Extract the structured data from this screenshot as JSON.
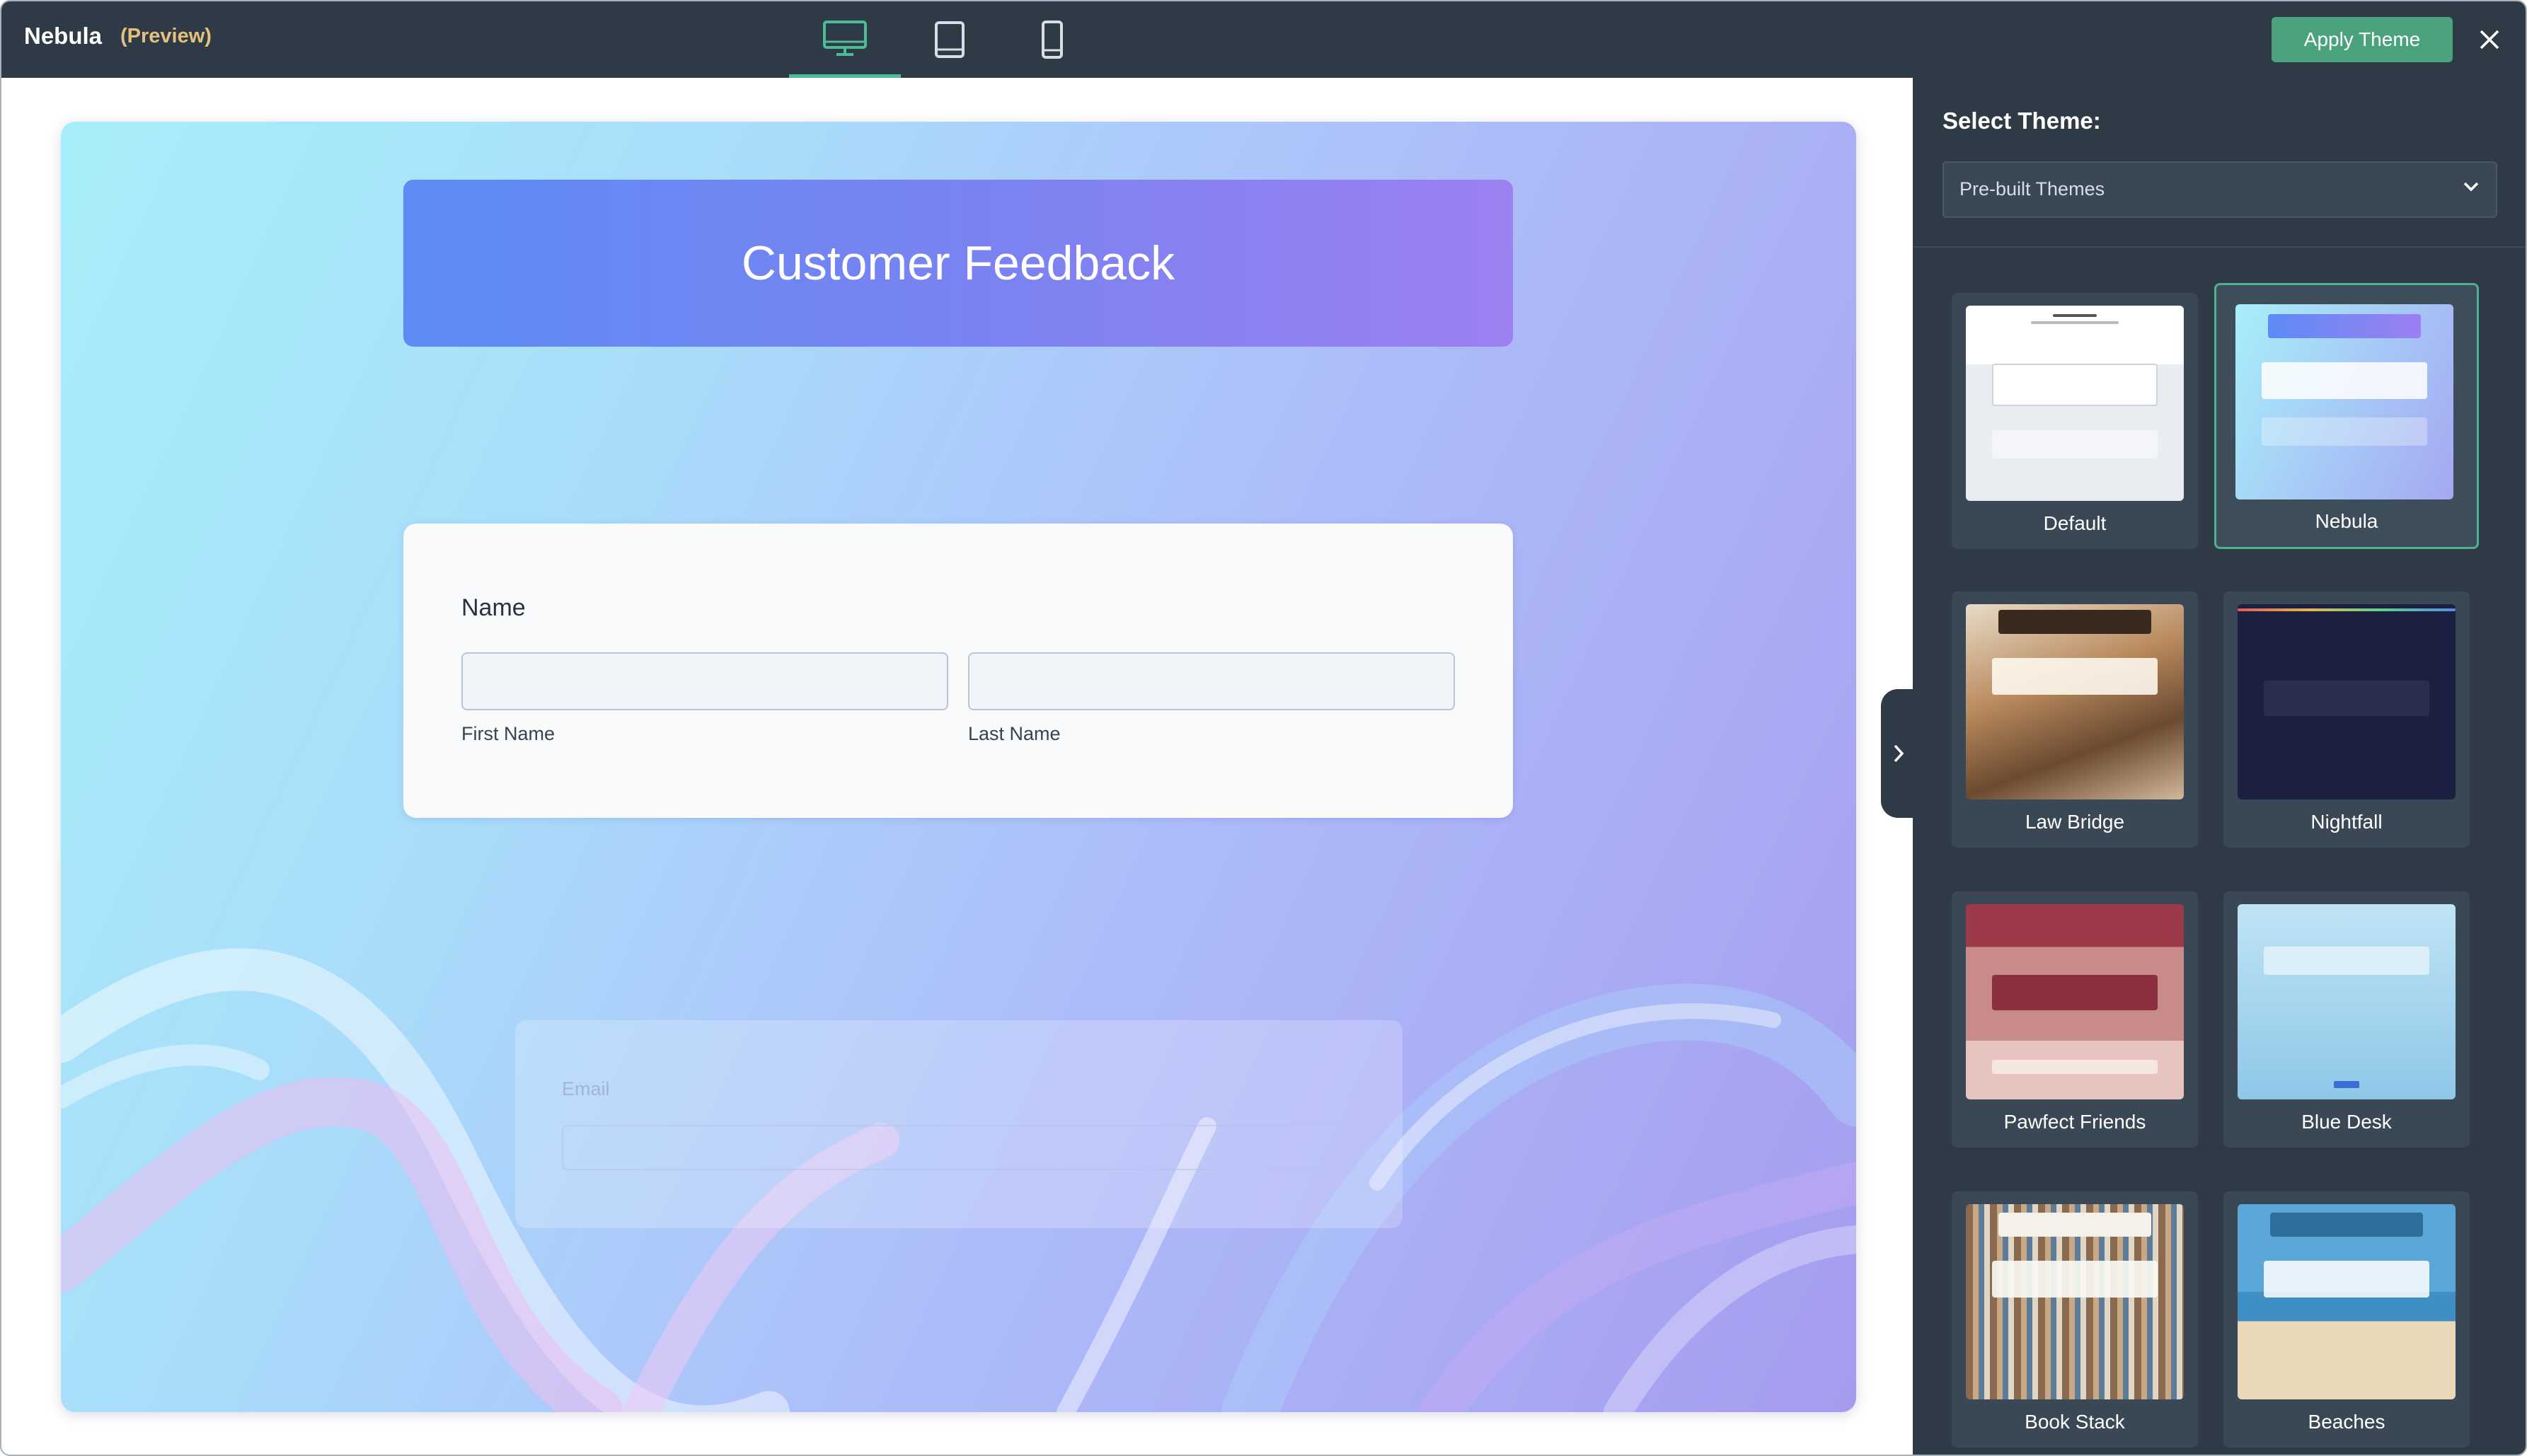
{
  "app": {
    "title": "Nebula",
    "preview_tag": "(Preview)",
    "apply_label": "Apply Theme"
  },
  "device_toggle": [
    {
      "name": "desktop",
      "icon": "desktop-icon",
      "active": true
    },
    {
      "name": "tablet",
      "icon": "tablet-icon",
      "active": false
    },
    {
      "name": "mobile",
      "icon": "mobile-icon",
      "active": false
    }
  ],
  "form": {
    "title": "Customer Feedback",
    "name_label": "Name",
    "first_name_label": "First Name",
    "last_name_label": "Last Name",
    "email_label": "Email"
  },
  "sidebar": {
    "select_label": "Select Theme:",
    "select_value": "Pre-built Themes",
    "themes": [
      {
        "name": "Default",
        "selected": false
      },
      {
        "name": "Nebula",
        "selected": true
      },
      {
        "name": "Law Bridge",
        "selected": false
      },
      {
        "name": "Nightfall",
        "selected": false
      },
      {
        "name": "Pawfect Friends",
        "selected": false
      },
      {
        "name": "Blue Desk",
        "selected": false
      },
      {
        "name": "Book Stack",
        "selected": false
      },
      {
        "name": "Beaches",
        "selected": false
      }
    ]
  },
  "colors": {
    "topbar": "#2e3b47",
    "accent": "#4aa37c",
    "preview_tag": "#e7c07e"
  }
}
